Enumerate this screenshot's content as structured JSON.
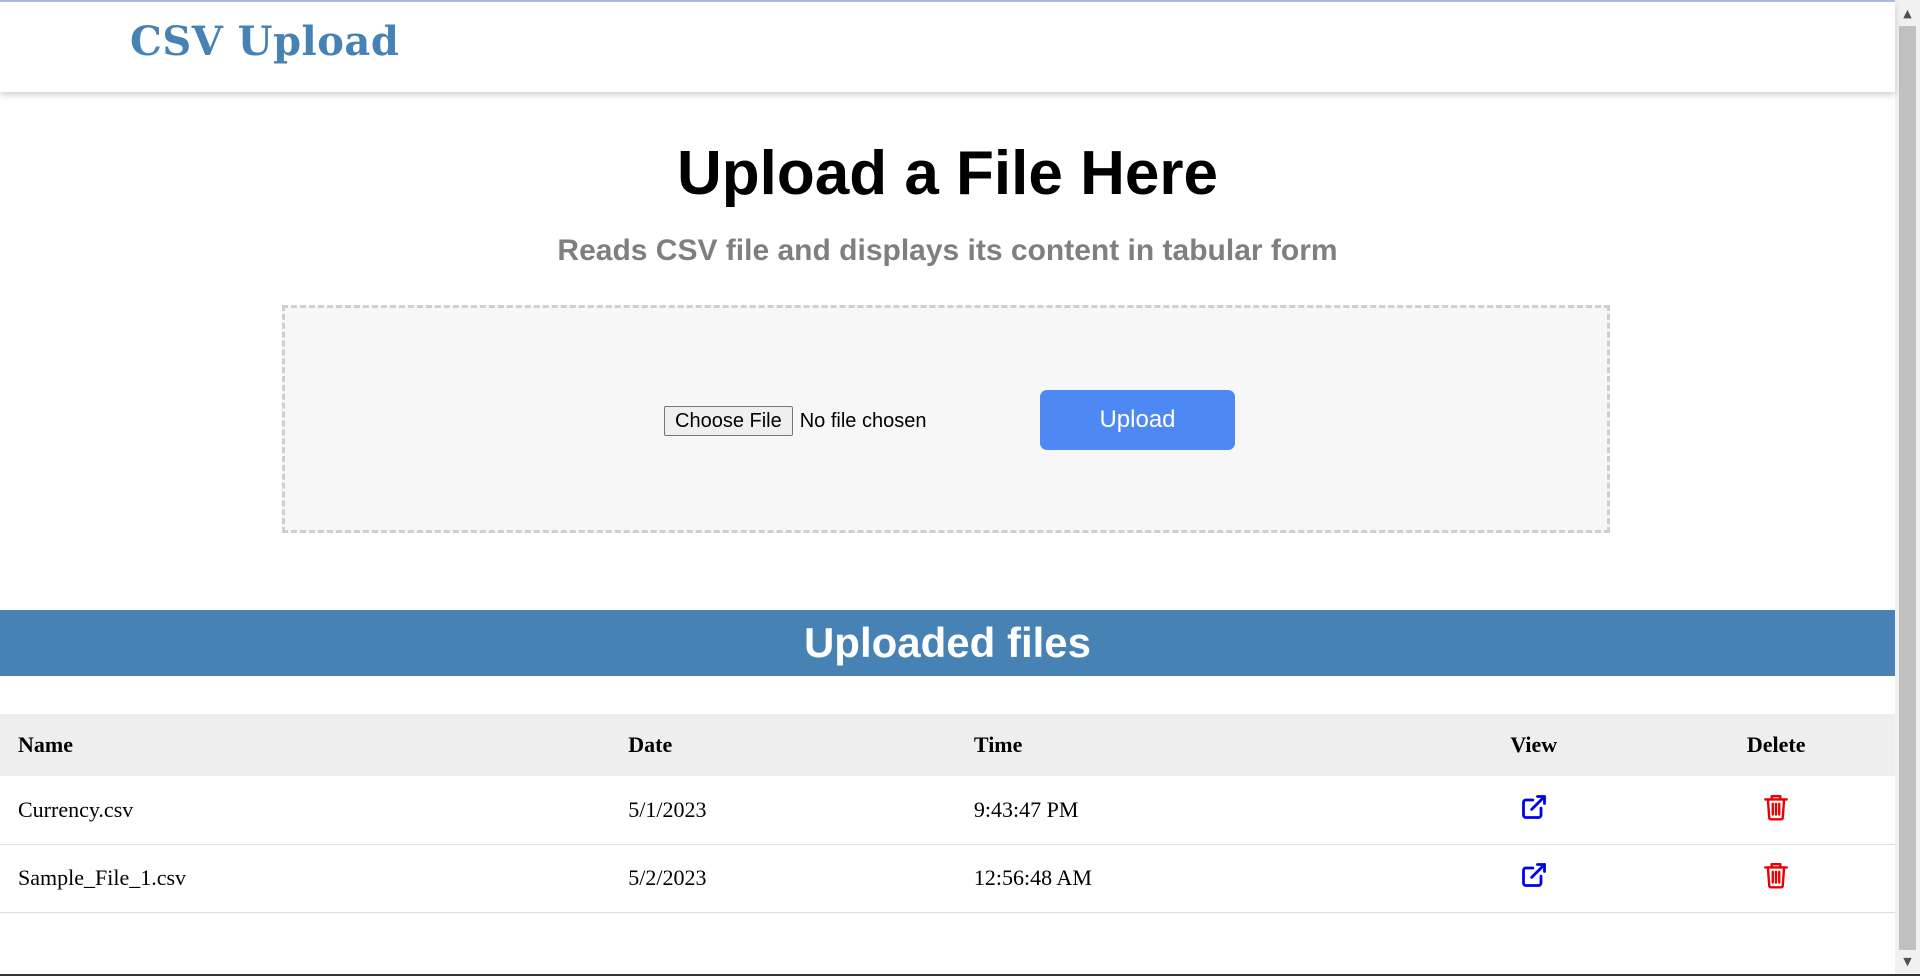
{
  "navbar": {
    "brand": "CSV Upload"
  },
  "hero": {
    "title": "Upload a File Here",
    "subtitle": "Reads CSV file and displays its content in tabular form"
  },
  "upload": {
    "choose_label": "Choose File",
    "no_file_text": "No file chosen",
    "upload_label": "Upload"
  },
  "files_section": {
    "heading": "Uploaded files",
    "columns": [
      "Name",
      "Date",
      "Time",
      "View",
      "Delete"
    ],
    "rows": [
      {
        "name": "Currency.csv",
        "date": "5/1/2023",
        "time": "9:43:47 PM",
        "view_icon": "external-link-icon",
        "delete_icon": "trash-icon"
      },
      {
        "name": "Sample_File_1.csv",
        "date": "5/2/2023",
        "time": "12:56:48 AM",
        "view_icon": "external-link-icon",
        "delete_icon": "trash-icon"
      }
    ]
  },
  "colors": {
    "brand": "#4682b4",
    "upload_button": "#4d88f5",
    "view_icon": "#0000ee",
    "delete_icon": "#e60000"
  }
}
